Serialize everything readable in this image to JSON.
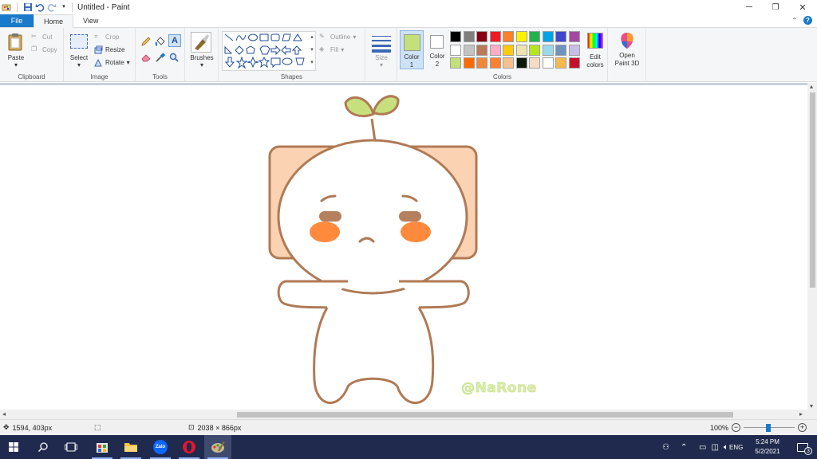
{
  "window": {
    "title": "Untitled - Paint"
  },
  "tabs": [
    {
      "label": "File"
    },
    {
      "label": "Home"
    },
    {
      "label": "View"
    }
  ],
  "ribbon": {
    "clipboard": {
      "paste": "Paste",
      "cut": "Cut",
      "copy": "Copy",
      "group": "Clipboard"
    },
    "image": {
      "select": "Select",
      "crop": "Crop",
      "resize": "Resize",
      "rotate": "Rotate",
      "group": "Image"
    },
    "tools": {
      "group": "Tools"
    },
    "brushes": {
      "label": "Brushes"
    },
    "shapes": {
      "outline": "Outline",
      "fill": "Fill",
      "group": "Shapes"
    },
    "size": {
      "label": "Size"
    },
    "colors": {
      "color1_label": "Color\n1",
      "color1_line1": "Color",
      "color1_line2": "1",
      "color2_line1": "Color",
      "color2_line2": "2",
      "color1_value": "#c3e07b",
      "color2_value": "#ffffff",
      "edit_line1": "Edit",
      "edit_line2": "colors",
      "group": "Colors",
      "palette_row1": [
        "#000000",
        "#7f7f7f",
        "#880015",
        "#ed1c24",
        "#ff7f27",
        "#fff200",
        "#22b14c",
        "#00a2e8",
        "#3f48cc",
        "#a349a4"
      ],
      "palette_row2": [
        "#ffffff",
        "#c3c3c3",
        "#b97a57",
        "#ffaec9",
        "#ffc90e",
        "#efe4b0",
        "#b5e61d",
        "#99d9ea",
        "#7092be",
        "#c8bfe7"
      ],
      "palette_row3": [
        "#c3e07b",
        "#ff6a00",
        "#f0883a",
        "#ff8030",
        "#f7bf8b",
        "#0b1a0b",
        "#f6dcc4",
        "#ffffff",
        "#f5b94f",
        "#c8102e"
      ]
    },
    "paint3d": {
      "line1": "Open",
      "line2": "Paint 3D"
    }
  },
  "canvas": {
    "watermark": "@NaRone",
    "colors": {
      "outline": "#b07a55",
      "ears": "#fbd3b3",
      "leaf": "#c7e07d",
      "cheek": "#ff8a3d",
      "brow": "#b5805f"
    }
  },
  "status": {
    "cursor_pos": "1594, 403px",
    "image_size": "2038 × 866px",
    "zoom": "100%"
  },
  "taskbar": {
    "language": "ENG",
    "time": "5:24 PM",
    "date": "5/2/2021",
    "notifications": "3",
    "zalo": "Zalo"
  }
}
